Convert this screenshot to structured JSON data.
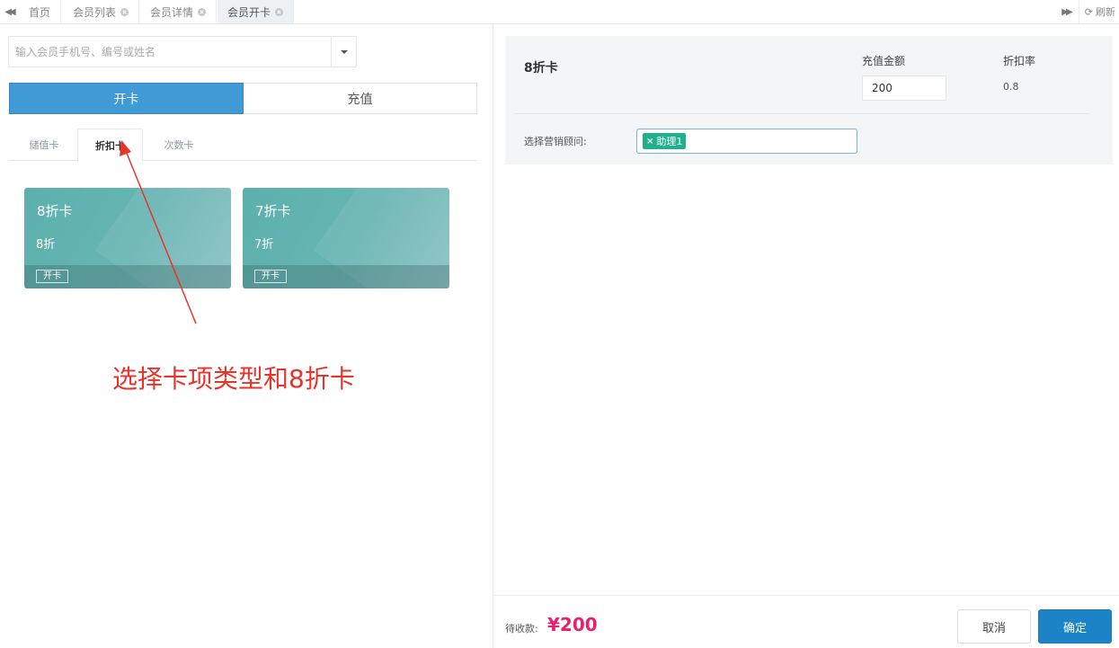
{
  "tabbar": {
    "tabs": [
      {
        "label": "首页"
      },
      {
        "label": "会员列表"
      },
      {
        "label": "会员详情"
      },
      {
        "label": "会员开卡"
      }
    ],
    "active_index": 3,
    "refresh_label": "刷新"
  },
  "search": {
    "placeholder": "输入会员手机号、编号或姓名"
  },
  "mode_tabs": {
    "open_label": "开卡",
    "recharge_label": "充值",
    "active": "开卡"
  },
  "card_type_tabs": {
    "items": [
      "储值卡",
      "折扣卡",
      "次数卡"
    ],
    "active": "折扣卡"
  },
  "cards": [
    {
      "name": "8折卡",
      "discount": "8折",
      "action": "开卡"
    },
    {
      "name": "7折卡",
      "discount": "7折",
      "action": "开卡"
    }
  ],
  "annotation": {
    "text": "选择卡项类型和8折卡",
    "color": "#e8332b"
  },
  "detail": {
    "card_title": "8折卡",
    "amount_label": "充值金额",
    "amount_value": "200",
    "rate_label": "折扣率",
    "rate_value": "0.8",
    "advisor_label": "选择营销顾问:",
    "advisors": [
      "助理1"
    ]
  },
  "footer": {
    "due_label": "待收款:",
    "due_amount": "¥200",
    "cancel_label": "取消",
    "confirm_label": "确定"
  },
  "colors": {
    "primary": "#3f9ad6",
    "confirm": "#1c84c6",
    "card": "#5cb0ad",
    "chip": "#21b08c",
    "due": "#e8216e"
  }
}
